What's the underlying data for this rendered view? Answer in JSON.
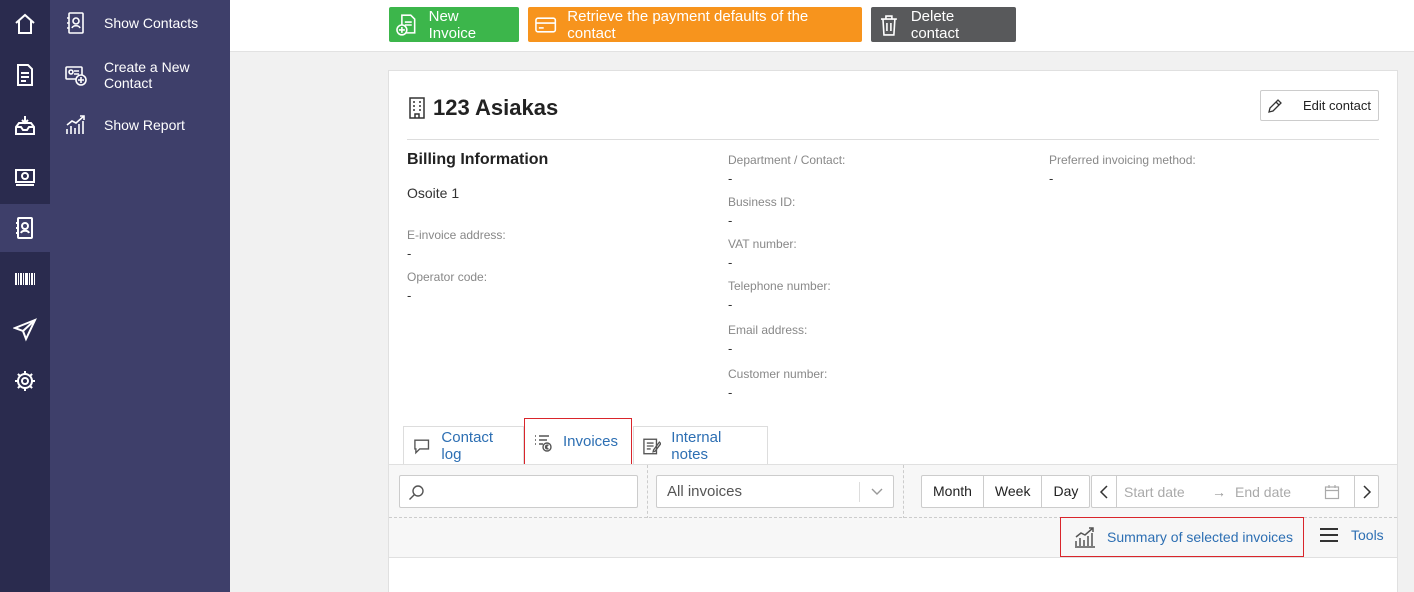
{
  "rail": {
    "icons": [
      "home-icon",
      "invoice-icon",
      "inbox-icon",
      "money-icon",
      "contacts-icon",
      "barcode-icon",
      "send-icon",
      "settings-icon"
    ],
    "active_index": 4
  },
  "submenu": {
    "items": [
      {
        "label": "Show Contacts",
        "icon": "contact-book-icon"
      },
      {
        "label": "Create a New Contact",
        "icon": "add-contact-icon"
      },
      {
        "label": "Show Report",
        "icon": "report-chart-icon"
      }
    ]
  },
  "toolbar": {
    "new_invoice": "New Invoice",
    "retrieve_defaults": "Retrieve the payment defaults of the contact",
    "delete_contact": "Delete contact"
  },
  "contact": {
    "name": "123 Asiakas",
    "edit_label": "Edit contact"
  },
  "billing": {
    "title": "Billing Information",
    "address": "Osoite 1",
    "einvoice_label": "E-invoice address:",
    "einvoice_value": "-",
    "operator_label": "Operator code:",
    "operator_value": "-"
  },
  "details": {
    "department_label": "Department / Contact:",
    "department_value": "-",
    "business_id_label": "Business ID:",
    "business_id_value": "-",
    "vat_label": "VAT number:",
    "vat_value": "-",
    "phone_label": "Telephone number:",
    "phone_value": "-",
    "email_label": "Email address:",
    "email_value": "-",
    "customer_no_label": "Customer number:",
    "customer_no_value": "-"
  },
  "preferences": {
    "method_label": "Preferred invoicing method:",
    "method_value": "-"
  },
  "tabs": {
    "contact_log": "Contact log",
    "invoices": "Invoices",
    "internal_notes": "Internal notes"
  },
  "filters": {
    "search_value": "",
    "invoice_filter": "All invoices",
    "period": [
      "Month",
      "Week",
      "Day"
    ],
    "start_placeholder": "Start date",
    "end_placeholder": "End date"
  },
  "actions": {
    "summary": "Summary of selected invoices",
    "tools": "Tools"
  },
  "colors": {
    "rail_bg": "#2a2b4e",
    "submenu_bg": "#3e3f6a",
    "green": "#3cb64b",
    "orange": "#f7941d",
    "gray": "#58595b",
    "link": "#2d6fb3",
    "highlight": "#d9252b"
  }
}
